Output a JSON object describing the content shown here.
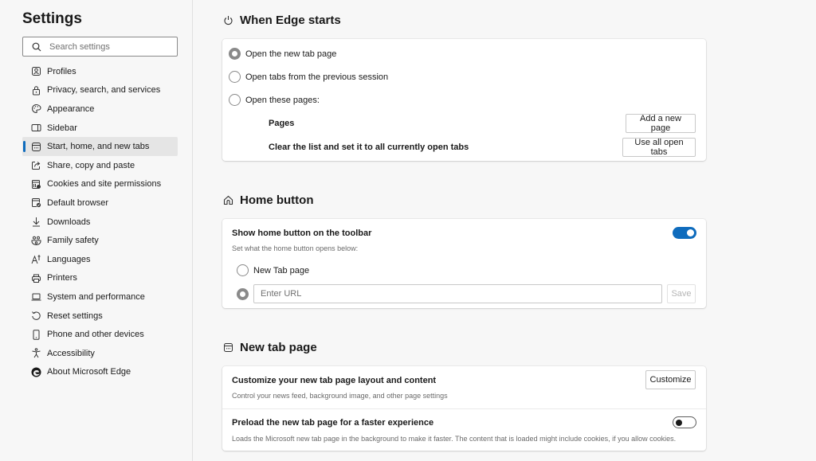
{
  "sidebar": {
    "title": "Settings",
    "search_placeholder": "Search settings",
    "items": [
      {
        "label": "Profiles",
        "icon": "profile-icon",
        "active": false
      },
      {
        "label": "Privacy, search, and services",
        "icon": "lock-icon",
        "active": false
      },
      {
        "label": "Appearance",
        "icon": "palette-icon",
        "active": false
      },
      {
        "label": "Sidebar",
        "icon": "sidebar-icon",
        "active": false
      },
      {
        "label": "Start, home, and new tabs",
        "icon": "browser-window-icon",
        "active": true
      },
      {
        "label": "Share, copy and paste",
        "icon": "share-icon",
        "active": false
      },
      {
        "label": "Cookies and site permissions",
        "icon": "cookies-icon",
        "active": false
      },
      {
        "label": "Default browser",
        "icon": "default-browser-icon",
        "active": false
      },
      {
        "label": "Downloads",
        "icon": "download-icon",
        "active": false
      },
      {
        "label": "Family safety",
        "icon": "family-icon",
        "active": false
      },
      {
        "label": "Languages",
        "icon": "languages-icon",
        "active": false
      },
      {
        "label": "Printers",
        "icon": "printer-icon",
        "active": false
      },
      {
        "label": "System and performance",
        "icon": "laptop-icon",
        "active": false
      },
      {
        "label": "Reset settings",
        "icon": "reset-icon",
        "active": false
      },
      {
        "label": "Phone and other devices",
        "icon": "phone-icon",
        "active": false
      },
      {
        "label": "Accessibility",
        "icon": "accessibility-icon",
        "active": false
      },
      {
        "label": "About Microsoft Edge",
        "icon": "edge-logo-icon",
        "active": false
      }
    ]
  },
  "when_edge_starts": {
    "title": "When Edge starts",
    "options": [
      {
        "label": "Open the new tab page",
        "checked": true
      },
      {
        "label": "Open tabs from the previous session",
        "checked": false
      },
      {
        "label": "Open these pages:",
        "checked": false
      }
    ],
    "pages_label": "Pages",
    "add_page_button": "Add a new page",
    "clear_list_label": "Clear the list and set it to all currently open tabs",
    "use_all_tabs_button": "Use all open tabs"
  },
  "home_button": {
    "title": "Home button",
    "show_label": "Show home button on the toolbar",
    "show_enabled": true,
    "sub_label": "Set what the home button opens below:",
    "option_new_tab": "New Tab page",
    "option_new_tab_checked": false,
    "option_url_checked": true,
    "url_placeholder": "Enter URL",
    "url_value": "",
    "save_button": "Save"
  },
  "new_tab_page": {
    "title": "New tab page",
    "customize_label": "Customize your new tab page layout and content",
    "customize_sub": "Control your news feed, background image, and other page settings",
    "customize_button": "Customize",
    "preload_label": "Preload the new tab page for a faster experience",
    "preload_sub": "Loads the Microsoft new tab page in the background to make it faster. The content that is loaded might include cookies, if you allow cookies.",
    "preload_enabled": false
  },
  "colors": {
    "accent": "#0f6cbd",
    "background": "#f7f7f7",
    "card": "#ffffff",
    "active_nav": "#e5e5e5"
  }
}
